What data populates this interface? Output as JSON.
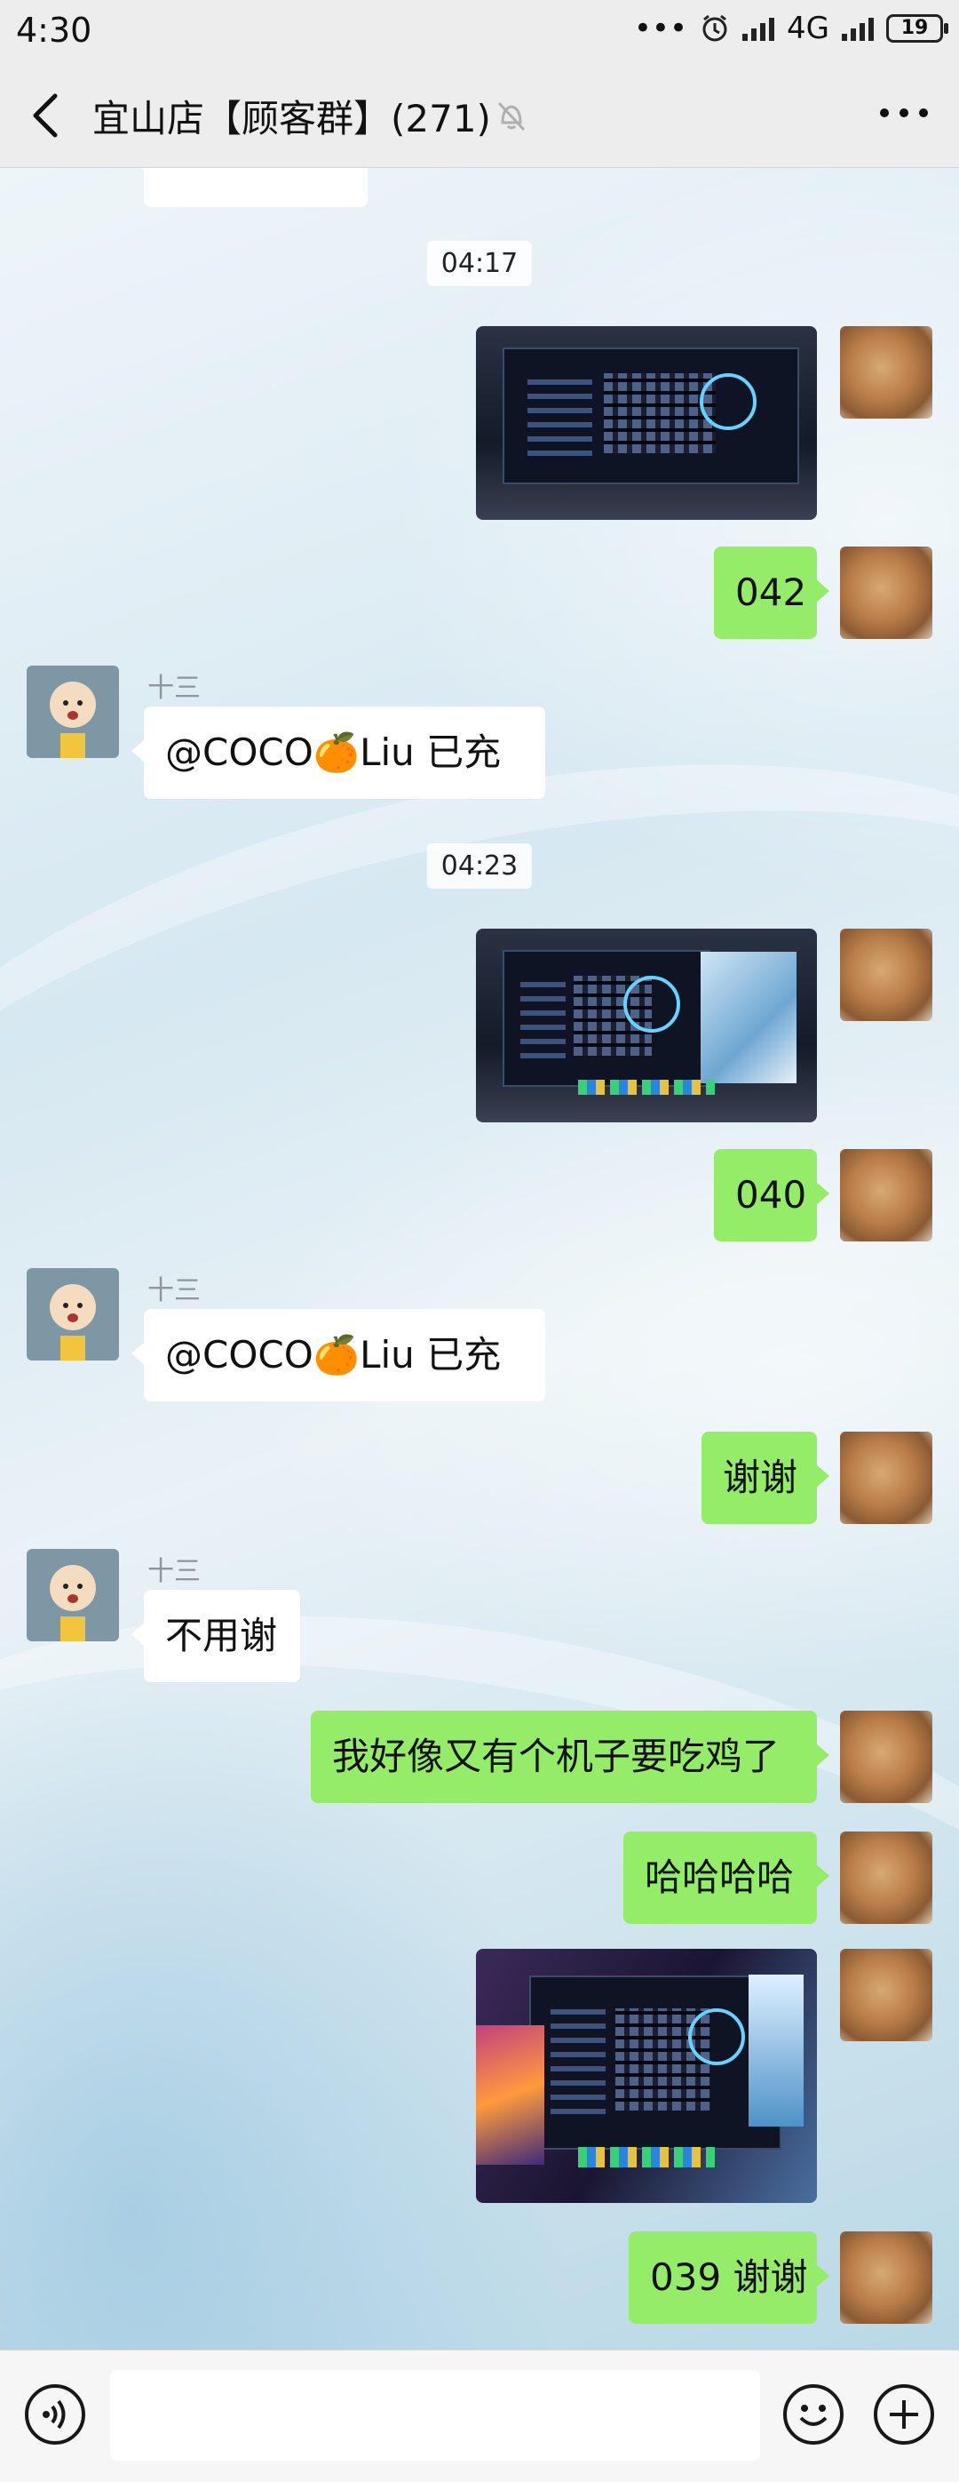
{
  "status_bar": {
    "time": "4:30",
    "network": "4G",
    "battery": "19"
  },
  "header": {
    "title": "宜山店【顾客群】(271)",
    "back_icon": "back-chevron-icon",
    "mute_icon": "muted-bell-icon",
    "more_icon": "more-dots-icon"
  },
  "chat": {
    "timestamps": [
      "04:17",
      "04:23"
    ],
    "messages": [
      {
        "type": "image",
        "from": "me",
        "description_icon": "game-screenshot-photo"
      },
      {
        "type": "text",
        "from": "me",
        "text": "042"
      },
      {
        "type": "text",
        "from": "other",
        "sender": "十三",
        "text": "@COCO🍊Liu 已充"
      },
      {
        "type": "image",
        "from": "me",
        "description_icon": "game-screenshot-photo"
      },
      {
        "type": "text",
        "from": "me",
        "text": "040"
      },
      {
        "type": "text",
        "from": "other",
        "sender": "十三",
        "text": "@COCO🍊Liu 已充"
      },
      {
        "type": "text",
        "from": "me",
        "text": "谢谢"
      },
      {
        "type": "text",
        "from": "other",
        "sender": "十三",
        "text": "不用谢"
      },
      {
        "type": "text",
        "from": "me",
        "text": "我好像又有个机子要吃鸡了"
      },
      {
        "type": "text",
        "from": "me",
        "text": "哈哈哈哈"
      },
      {
        "type": "image",
        "from": "me",
        "description_icon": "game-screenshot-photo"
      },
      {
        "type": "text",
        "from": "me",
        "text": "039 谢谢"
      }
    ]
  },
  "input_bar": {
    "voice_icon": "voice-icon",
    "emoji_icon": "emoji-icon",
    "plus_icon": "plus-icon",
    "input_value": ""
  },
  "colors": {
    "my_bubble": "#95ec69",
    "other_bubble": "#ffffff",
    "header_bg": "#ededed"
  }
}
